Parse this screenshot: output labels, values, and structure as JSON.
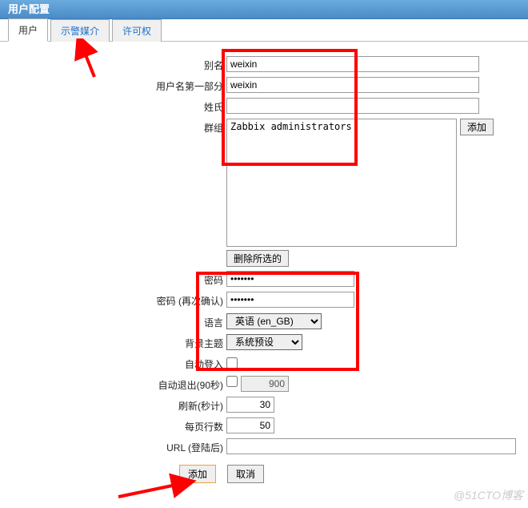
{
  "header": {
    "title": "用户配置"
  },
  "tabs": {
    "user": "用户",
    "media": "示警媒介",
    "perm": "许可权"
  },
  "form": {
    "alias_label": "别名",
    "alias_value": "weixin",
    "name_label": "用户名第一部分",
    "name_value": "weixin",
    "surname_label": "姓氏",
    "surname_value": "",
    "groups_label": "群组",
    "groups_value": "Zabbix administrators",
    "add_group_btn": "添加",
    "delete_selected_btn": "删除所选的",
    "password_label": "密码",
    "password_value": "●●●●●●●",
    "password_confirm_label": "密码 (再次确认)",
    "password_confirm_value": "●●●●●●●",
    "language_label": "语言",
    "language_value": "英语 (en_GB)",
    "theme_label": "背景主题",
    "theme_value": "系统预设",
    "autologin_label": "自动登入",
    "autologout_label": "自动退出(90秒)",
    "autologout_value": "900",
    "refresh_label": "刷新(秒计)",
    "refresh_value": "30",
    "rows_label": "每页行数",
    "rows_value": "50",
    "url_label": "URL (登陆后)",
    "url_value": ""
  },
  "buttons": {
    "submit": "添加",
    "cancel": "取消"
  },
  "watermark": "@51CTO博客"
}
